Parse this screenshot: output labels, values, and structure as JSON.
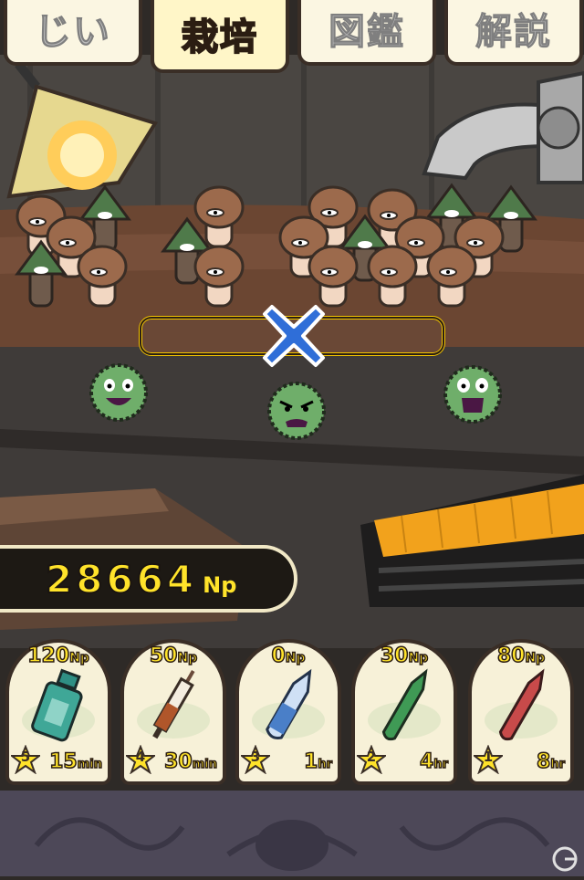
{
  "tabs": [
    {
      "label": "じい",
      "active": false
    },
    {
      "label": "栽培",
      "active": true
    },
    {
      "label": "図鑑",
      "active": false
    },
    {
      "label": "解説",
      "active": false
    }
  ],
  "np": {
    "value": "28664",
    "unit": "Np"
  },
  "items": [
    {
      "price": "120",
      "price_unit": "Np",
      "rank": "5",
      "time": "15",
      "time_unit": "min",
      "icon": "teal-bottle-icon",
      "color": "#2f8f84"
    },
    {
      "price": "50",
      "price_unit": "Np",
      "rank": "4",
      "time": "30",
      "time_unit": "min",
      "icon": "syringe-icon",
      "color": "#b0562a"
    },
    {
      "price": "0",
      "price_unit": "Np",
      "rank": "3",
      "time": "1",
      "time_unit": "hr",
      "icon": "blue-vial-icon",
      "color": "#4a7fc8"
    },
    {
      "price": "30",
      "price_unit": "Np",
      "rank": "2",
      "time": "4",
      "time_unit": "hr",
      "icon": "green-vial-icon",
      "color": "#3f9a55"
    },
    {
      "price": "80",
      "price_unit": "Np",
      "rank": "1",
      "time": "8",
      "time_unit": "hr",
      "icon": "red-vial-icon",
      "color": "#c84a4a"
    }
  ],
  "harvest_bar": {
    "fill": 0.0
  }
}
